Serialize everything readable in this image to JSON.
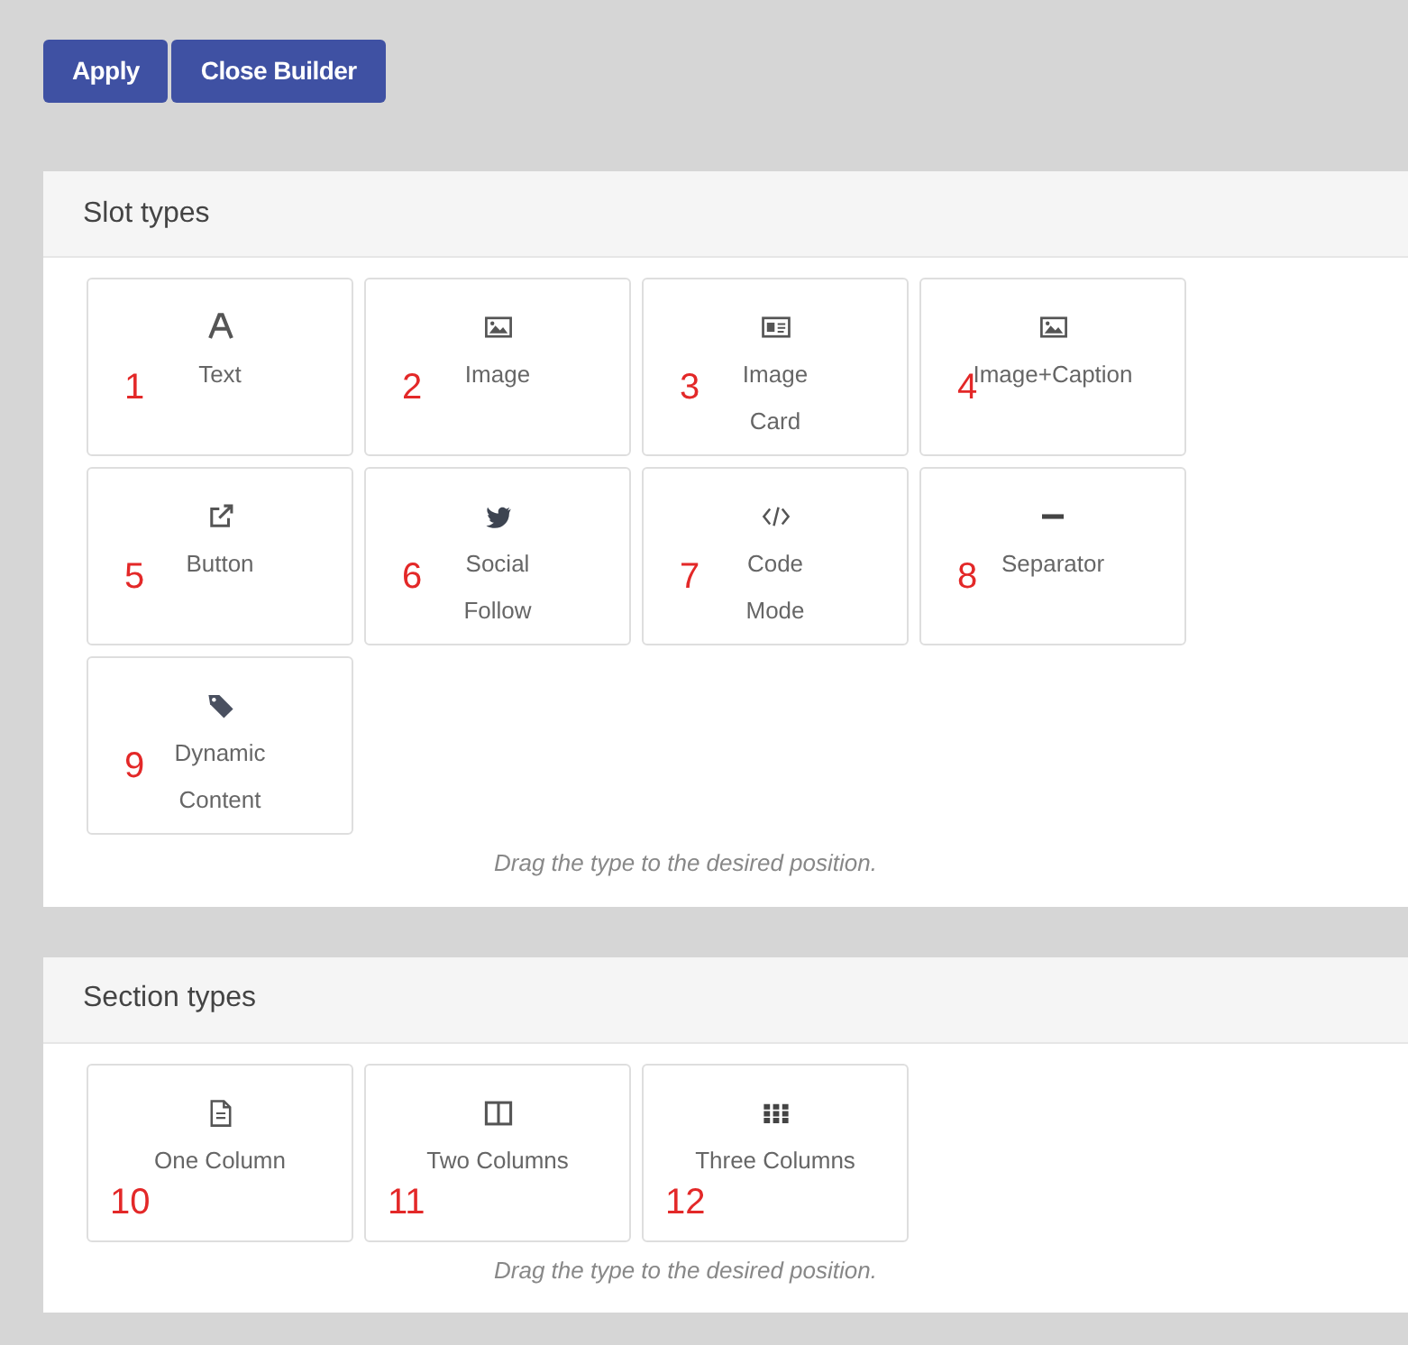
{
  "toolbar": {
    "buttons": [
      "Apply",
      "Close Builder"
    ]
  },
  "panels": [
    {
      "title": "Slot types",
      "hint": "Drag the type to the desired position.",
      "tiles": [
        {
          "kind": "letter",
          "lines": [
            "Text"
          ],
          "marker": "1"
        },
        {
          "kind": "image",
          "lines": [
            "Image"
          ],
          "marker": "2"
        },
        {
          "kind": "card",
          "lines": [
            "Image",
            "Card"
          ],
          "marker": "3"
        },
        {
          "kind": "image",
          "lines": [
            "Image+Caption"
          ],
          "marker": "4"
        },
        {
          "kind": "external",
          "lines": [
            "Button"
          ],
          "marker": "5"
        },
        {
          "kind": "bird",
          "lines": [
            "Social",
            "Follow"
          ],
          "marker": "6"
        },
        {
          "kind": "code",
          "lines": [
            "Code",
            "Mode"
          ],
          "marker": "7"
        },
        {
          "kind": "minus",
          "lines": [
            "Separator"
          ],
          "marker": "8"
        },
        {
          "kind": "tag",
          "lines": [
            "Dynamic",
            "Content"
          ],
          "marker": "9"
        }
      ]
    },
    {
      "title": "Section types",
      "hint": "Drag the type to the desired position.",
      "tiles": [
        {
          "kind": "file",
          "lines": [
            "One Column"
          ],
          "marker": "10"
        },
        {
          "kind": "columns",
          "lines": [
            "Two Columns"
          ],
          "marker": "11"
        },
        {
          "kind": "grid",
          "lines": [
            "Three Columns"
          ],
          "marker": "12"
        }
      ]
    }
  ]
}
